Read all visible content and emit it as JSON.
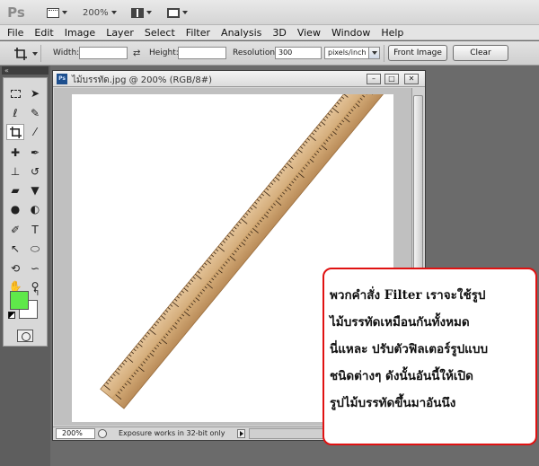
{
  "app": {
    "logo": "Ps",
    "zoom_level": "200%"
  },
  "menu": [
    "File",
    "Edit",
    "Image",
    "Layer",
    "Select",
    "Filter",
    "Analysis",
    "3D",
    "View",
    "Window",
    "Help"
  ],
  "options": {
    "width_label": "Width:",
    "width_value": "",
    "height_label": "Height:",
    "height_value": "",
    "resolution_label": "Resolution:",
    "resolution_value": "300",
    "resolution_unit": "pixels/inch",
    "front_image_label": "Front Image",
    "clear_label": "Clear"
  },
  "tools_header": "«",
  "document": {
    "title": "ไม้บรรทัด.jpg @ 200% (RGB/8#)",
    "zoom": "200%",
    "status": "Exposure works in 32-bit only",
    "min_btn": "–",
    "max_btn": "□",
    "close_btn": "✕"
  },
  "colors": {
    "foreground": "#5fe84a",
    "background": "#ffffff",
    "callout_border": "#e01212"
  },
  "callout": {
    "lines": [
      "พวกคำสั่ง Filter เราจะใช้รูป",
      "ไม้บรรทัดเหมือนกันทั้งหมด",
      "นี่แหละ ปรับตัวฟิลเตอร์รูปแบบ",
      "ชนิดต่างๆ ดังนั้นอันนี้ให้เปิด",
      "รูปไม้บรรทัดขึ้นมาอันนึง"
    ]
  }
}
